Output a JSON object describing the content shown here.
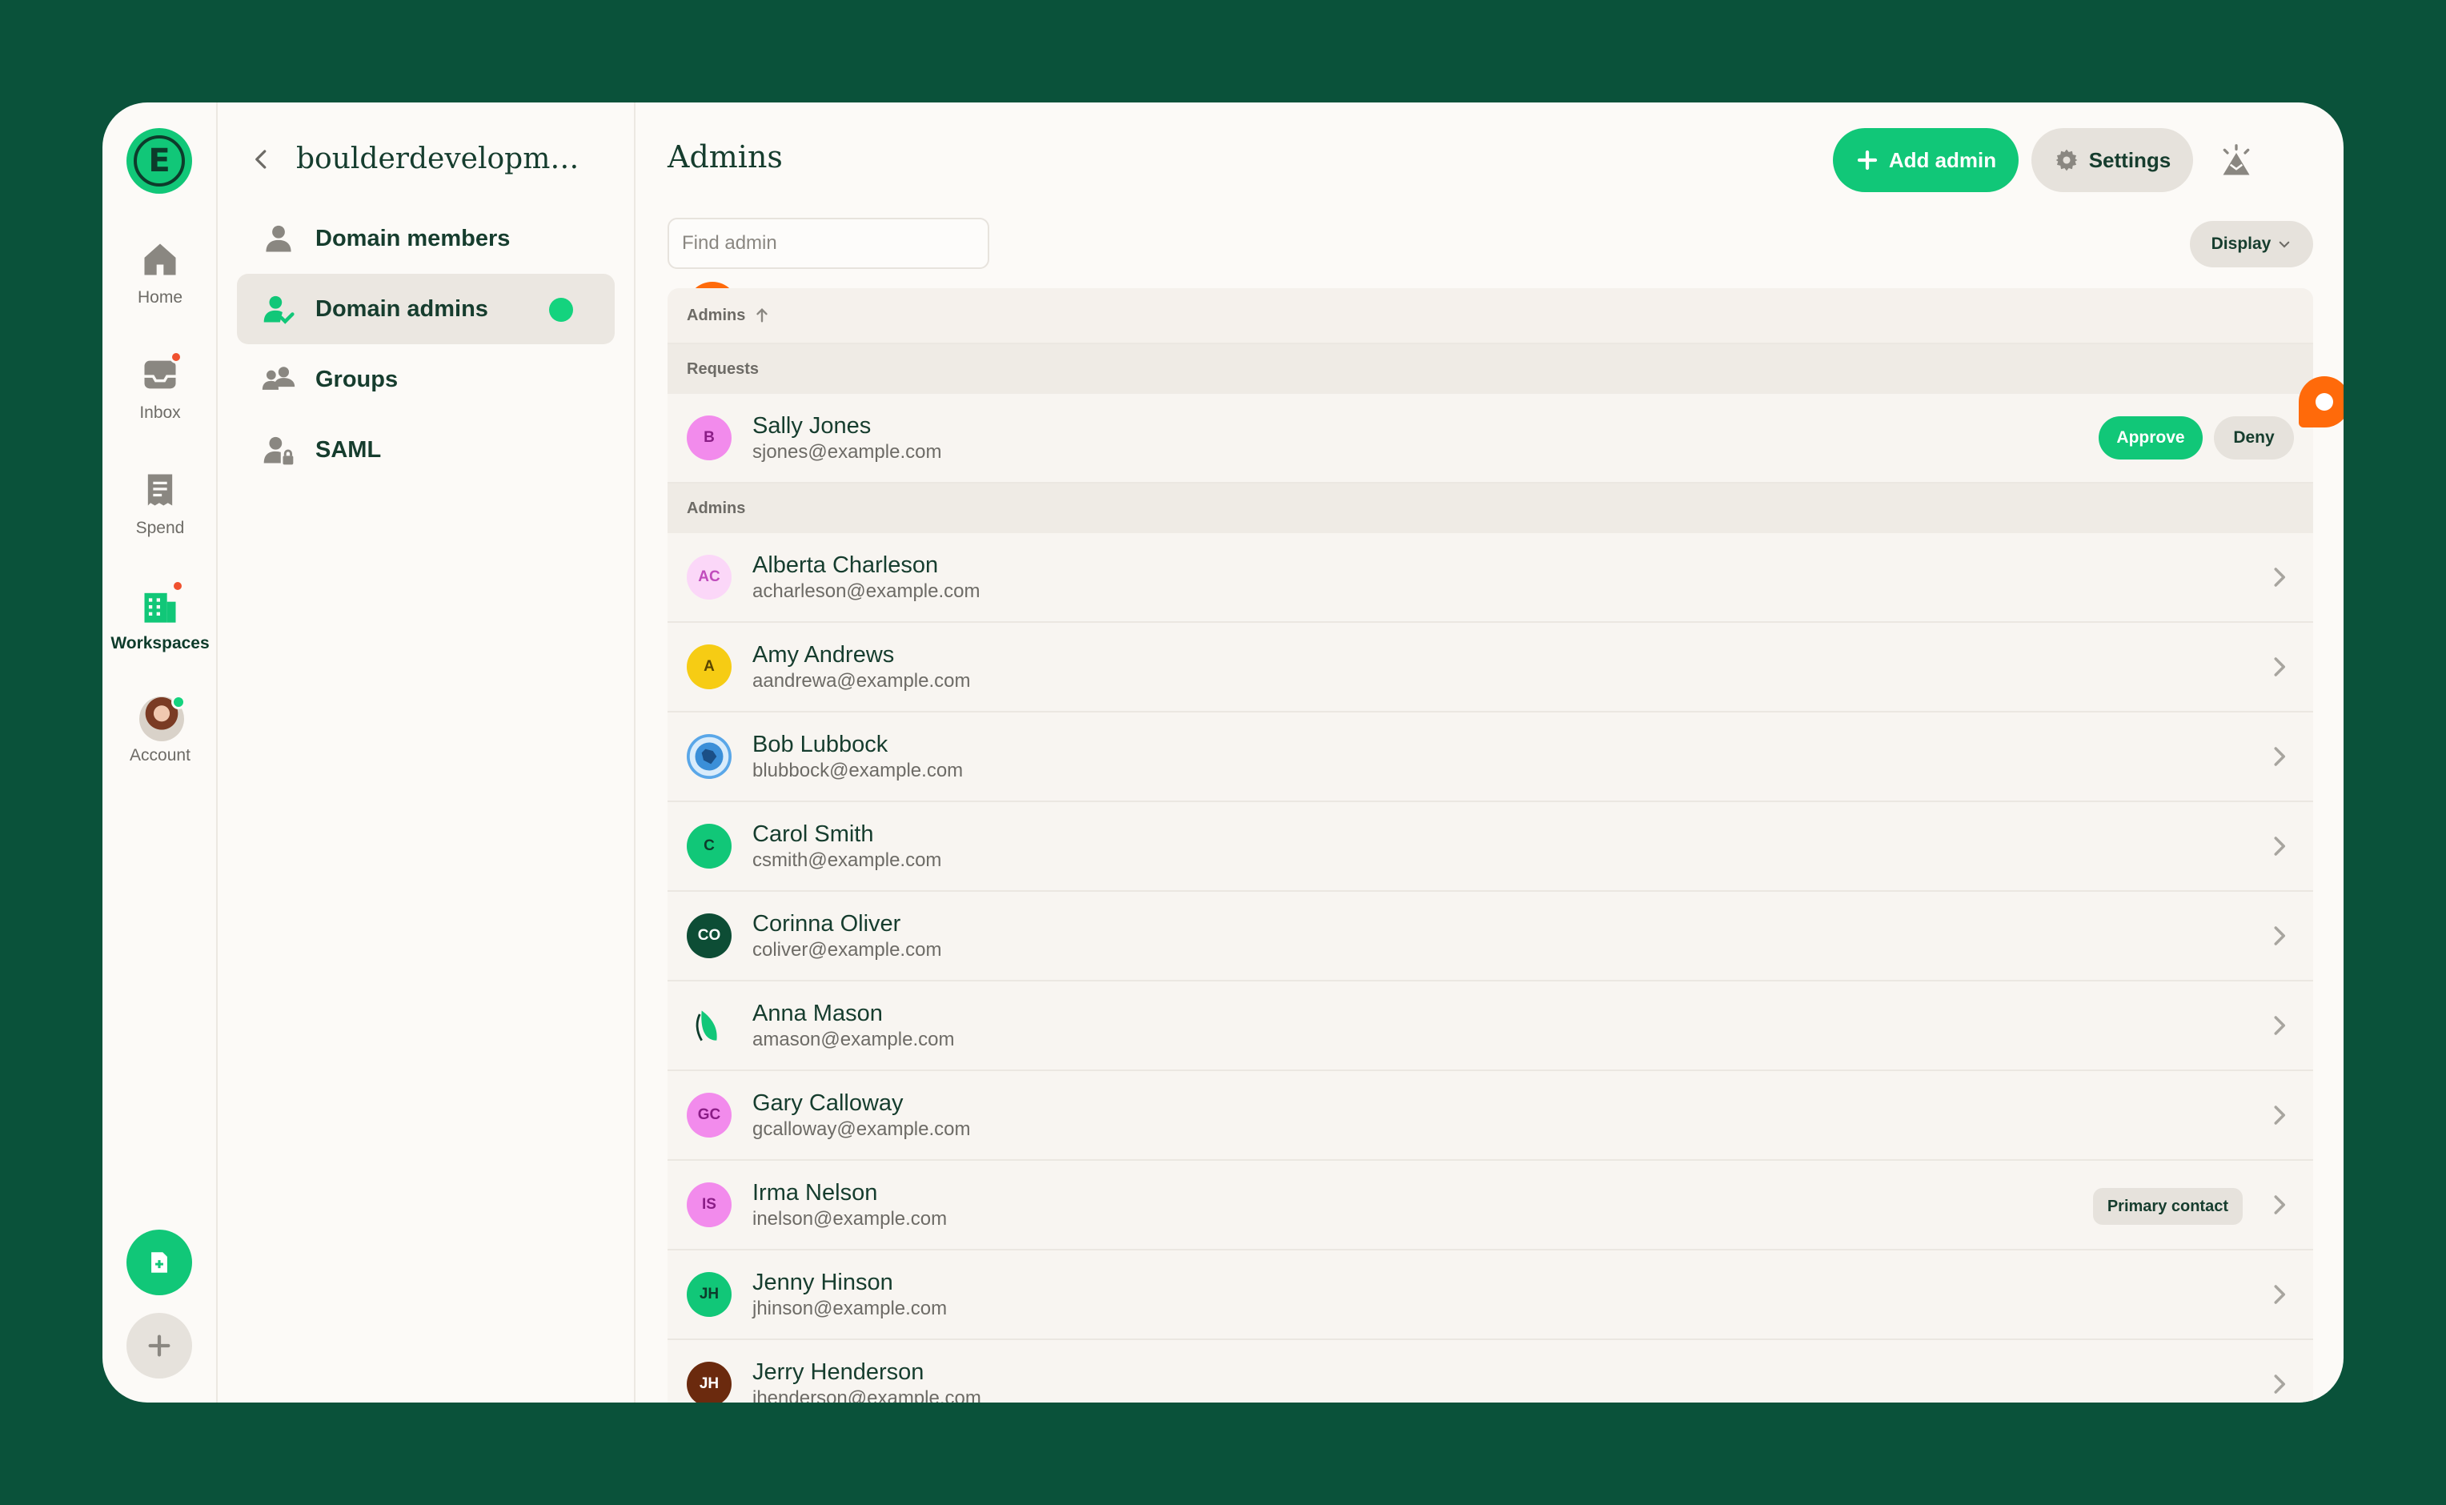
{
  "rail": {
    "items": [
      {
        "label": "Home",
        "icon": "home-icon"
      },
      {
        "label": "Inbox",
        "icon": "inbox-icon"
      },
      {
        "label": "Spend",
        "icon": "receipt-icon"
      },
      {
        "label": "Workspaces",
        "icon": "building-icon"
      },
      {
        "label": "Account",
        "icon": "avatar"
      }
    ],
    "active": "Workspaces"
  },
  "subnav": {
    "title": "boulderdevelopment",
    "items": [
      {
        "label": "Domain members",
        "icon": "person-icon"
      },
      {
        "label": "Domain admins",
        "icon": "person-check-icon"
      },
      {
        "label": "Groups",
        "icon": "group-icon"
      },
      {
        "label": "SAML",
        "icon": "person-lock-icon"
      }
    ],
    "active": "Domain admins"
  },
  "main": {
    "title": "Admins",
    "add_label": "Add admin",
    "settings_label": "Settings",
    "search": {
      "placeholder": "Find admin",
      "value": ""
    },
    "display_label": "Display",
    "table": {
      "header": "Admins",
      "requests_label": "Requests",
      "admins_label": "Admins",
      "approve_label": "Approve",
      "deny_label": "Deny",
      "requests": [
        {
          "initials": "B",
          "name": "Sally Jones",
          "email": "sjones@example.com",
          "color": "#f28bec",
          "fg": "#8a1d86"
        }
      ],
      "admins": [
        {
          "initials": "AC",
          "name": "Alberta Charleson",
          "email": "acharleson@example.com",
          "color": "#fbd7f8",
          "fg": "#c04cbc"
        },
        {
          "initials": "A",
          "name": "Amy Andrews",
          "email": "aandrewa@example.com",
          "color": "#f6cc14",
          "fg": "#5a4600"
        },
        {
          "initials": "",
          "name": "Bob Lubbock",
          "email": "blubbock@example.com",
          "color": "#5aa7e8",
          "fg": "#ffffff",
          "icon": "image-avatar-icon"
        },
        {
          "initials": "C",
          "name": "Carol Smith",
          "email": "csmith@example.com",
          "color": "#11c778",
          "fg": "#0d3b2b"
        },
        {
          "initials": "CO",
          "name": "Corinna Oliver",
          "email": "coliver@example.com",
          "color": "#0d4d35",
          "fg": "#ffffff"
        },
        {
          "initials": "",
          "name": "Anna Mason",
          "email": "amason@example.com",
          "color": "#f8f5f1",
          "fg": "#11c778",
          "icon": "leaf-avatar-icon"
        },
        {
          "initials": "GC",
          "name": "Gary Calloway",
          "email": "gcalloway@example.com",
          "color": "#f28bec",
          "fg": "#8a1d86"
        },
        {
          "initials": "IS",
          "name": "Irma Nelson",
          "email": "inelson@example.com",
          "color": "#f28bec",
          "fg": "#8a1d86",
          "badge": "Primary contact"
        },
        {
          "initials": "JH",
          "name": "Jenny Hinson",
          "email": "jhinson@example.com",
          "color": "#11c778",
          "fg": "#0d3b2b"
        },
        {
          "initials": "JH",
          "name": "Jerry Henderson",
          "email": "jhenderson@example.com",
          "color": "#6b2a0e",
          "fg": "#ffffff"
        }
      ]
    }
  },
  "colors": {
    "brand": "#11c778",
    "background": "#0a523a",
    "accent_pin": "#ff6a0a"
  }
}
